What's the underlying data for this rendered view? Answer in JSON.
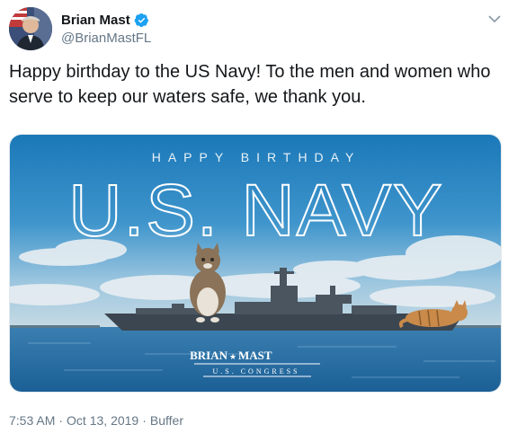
{
  "author": {
    "name": "Brian Mast",
    "handle": "@BrianMastFL",
    "verified": true,
    "avatar_icon": "avatar-photo"
  },
  "tweet": {
    "text": "Happy birthday to the US Navy! To the men and women who serve to keep our waters safe, we thank you."
  },
  "media": {
    "kicker": "HAPPY BIRTHDAY",
    "headline": "U.S. NAVY",
    "brand_name": "BRIAN",
    "brand_name_2": "MAST",
    "brand_sub": "U.S. CONGRESS"
  },
  "meta": {
    "time": "7:53 AM",
    "date": "Oct 13, 2019",
    "separator": "·",
    "source": "Buffer"
  },
  "colors": {
    "verified_blue": "#1da1f2",
    "secondary_text": "#657786"
  }
}
